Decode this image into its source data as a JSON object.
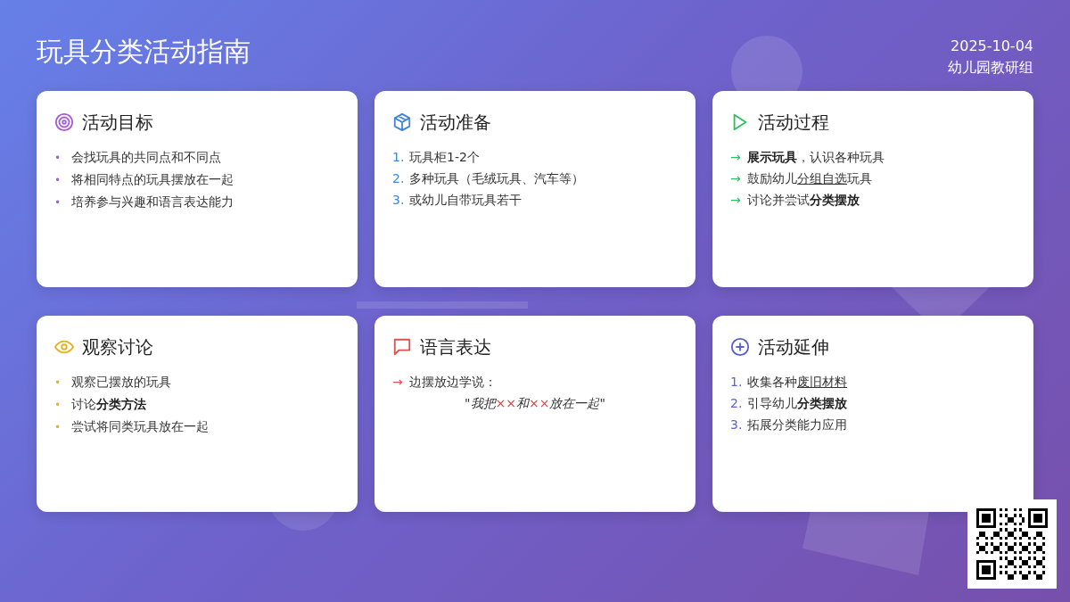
{
  "title": "玩具分类活动指南",
  "meta": [
    "2025-10-04",
    "幼儿园教研组"
  ],
  "cards": [
    {
      "title": "活动目标",
      "color": "#a35bd6",
      "items": [
        {
          "kind": "bullet",
          "marker": "•",
          "segments": [
            {
              "text": "会找玩具的共同点和不同点",
              "underlined": false,
              "highlighted": false
            }
          ]
        },
        {
          "kind": "bullet",
          "marker": "•",
          "segments": [
            {
              "text": "将相同特点的玩具摆放在一起",
              "underlined": false,
              "highlighted": false
            }
          ]
        },
        {
          "kind": "bullet",
          "marker": "•",
          "segments": [
            {
              "text": "培养参与兴趣和语言表达能力",
              "underlined": false,
              "highlighted": false
            }
          ]
        }
      ]
    },
    {
      "title": "活动准备",
      "color": "#3f86de",
      "items": [
        {
          "kind": "number",
          "marker": "1.",
          "segments": [
            {
              "text": "玩具柜1-2个",
              "underlined": false,
              "highlighted": false
            }
          ]
        },
        {
          "kind": "number",
          "marker": "2.",
          "segments": [
            {
              "text": "多种玩具（毛绒玩具、汽车等）",
              "underlined": false,
              "highlighted": false
            }
          ]
        },
        {
          "kind": "number",
          "marker": "3.",
          "segments": [
            {
              "text": "或幼儿自带玩具若干",
              "underlined": false,
              "highlighted": false
            }
          ]
        }
      ]
    },
    {
      "title": "活动过程",
      "color": "#2fbf5f",
      "items": [
        {
          "kind": "arrow",
          "marker": "→",
          "segments": [
            {
              "text": "**展示玩具**，认识各种玩具",
              "underlined": false,
              "highlighted": false
            }
          ]
        },
        {
          "kind": "arrow",
          "marker": "→",
          "segments": [
            {
              "text": "鼓励幼儿",
              "underlined": false,
              "highlighted": false
            },
            {
              "text": "分组自选",
              "underlined": true,
              "highlighted": false
            },
            {
              "text": "玩具",
              "underlined": false,
              "highlighted": false
            }
          ]
        },
        {
          "kind": "arrow",
          "marker": "→",
          "segments": [
            {
              "text": "讨论并尝试**分类摆放**",
              "underlined": false,
              "highlighted": false
            }
          ]
        }
      ]
    },
    {
      "title": "观察讨论",
      "color": "#e2b420",
      "items": [
        {
          "kind": "bullet",
          "marker": "•",
          "segments": [
            {
              "text": "观察已摆放的玩具",
              "underlined": false,
              "highlighted": false
            }
          ]
        },
        {
          "kind": "bullet",
          "marker": "•",
          "segments": [
            {
              "text": "讨论**分类方法**",
              "underlined": false,
              "highlighted": false
            }
          ]
        },
        {
          "kind": "bullet",
          "marker": "•",
          "segments": [
            {
              "text": "尝试将同类玩具放在一起",
              "underlined": false,
              "highlighted": false
            }
          ]
        }
      ]
    },
    {
      "title": "语言表达",
      "color": "#d9534f",
      "items": [
        {
          "kind": "arrow",
          "marker": "→",
          "segments": [
            {
              "text": "边摆放边学说：",
              "underlined": false,
              "highlighted": false
            }
          ]
        },
        {
          "kind": "quote",
          "segments": [
            {
              "text": "\"*我把*",
              "underlined": false,
              "highlighted": false
            },
            {
              "text": "××",
              "underlined": false,
              "highlighted": true
            },
            {
              "text": "*和*",
              "underlined": false,
              "highlighted": false
            },
            {
              "text": "××",
              "underlined": false,
              "highlighted": true
            },
            {
              "text": "*放在一起*\"",
              "underlined": false,
              "highlighted": false
            }
          ]
        }
      ]
    },
    {
      "title": "活动延伸",
      "color": "#5b5fd0",
      "items": [
        {
          "kind": "number",
          "marker": "1.",
          "segments": [
            {
              "text": "收集各种",
              "underlined": false,
              "highlighted": false
            },
            {
              "text": "废旧材料",
              "underlined": true,
              "highlighted": false
            }
          ]
        },
        {
          "kind": "number",
          "marker": "2.",
          "segments": [
            {
              "text": "引导幼儿**分类摆放**",
              "underlined": false,
              "highlighted": false
            }
          ]
        },
        {
          "kind": "number",
          "marker": "3.",
          "segments": [
            {
              "text": "拓展分类能力应用",
              "underlined": false,
              "highlighted": false
            }
          ]
        }
      ]
    }
  ]
}
